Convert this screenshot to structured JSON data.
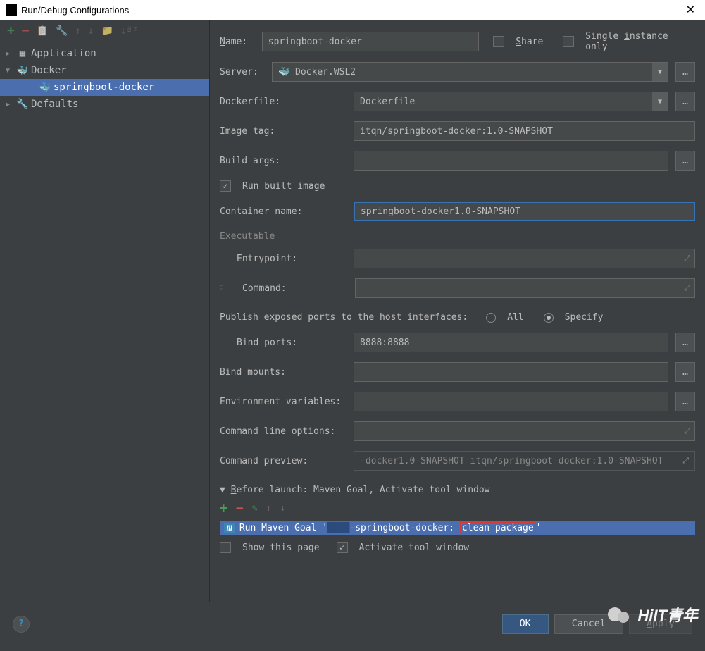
{
  "window": {
    "title": "Run/Debug Configurations"
  },
  "tree": {
    "application": "Application",
    "docker": "Docker",
    "springboot": "springboot-docker",
    "defaults": "Defaults"
  },
  "form": {
    "name_label": "Name:",
    "name_value": "springboot-docker",
    "share": "Share",
    "single_instance": "Single instance only",
    "server_label": "Server:",
    "server_value": "Docker.WSL2",
    "dockerfile_label": "Dockerfile:",
    "dockerfile_value": "Dockerfile",
    "imagetag_label": "Image tag:",
    "imagetag_value": "itqn/springboot-docker:1.0-SNAPSHOT",
    "buildargs_label": "Build args:",
    "runbuilt": "Run built image",
    "container_label": "Container name:",
    "container_value": "springboot-docker1.0-SNAPSHOT",
    "executable": "Executable",
    "entrypoint": "Entrypoint:",
    "command": "Command:",
    "publish_label": "Publish exposed ports to the host interfaces:",
    "all": "All",
    "specify": "Specify",
    "bindports_label": "Bind ports:",
    "bindports_value": "8888:8888",
    "bindmounts_label": "Bind mounts:",
    "envvars_label": "Environment variables:",
    "cmdopts_label": "Command line options:",
    "cmdpreview_label": "Command preview:",
    "cmdpreview_value": "-docker1.0-SNAPSHOT itqn/springboot-docker:1.0-SNAPSHOT"
  },
  "before_launch": {
    "header": "Before launch: Maven Goal, Activate tool window",
    "item_prefix": "Run Maven Goal '",
    "item_mid": "-springboot-docker: ",
    "item_goal": "clean package",
    "show_page": "Show this page",
    "activate": "Activate tool window"
  },
  "buttons": {
    "ok": "OK",
    "cancel": "Cancel",
    "apply": "Apply"
  },
  "watermark": "HiIT青年"
}
